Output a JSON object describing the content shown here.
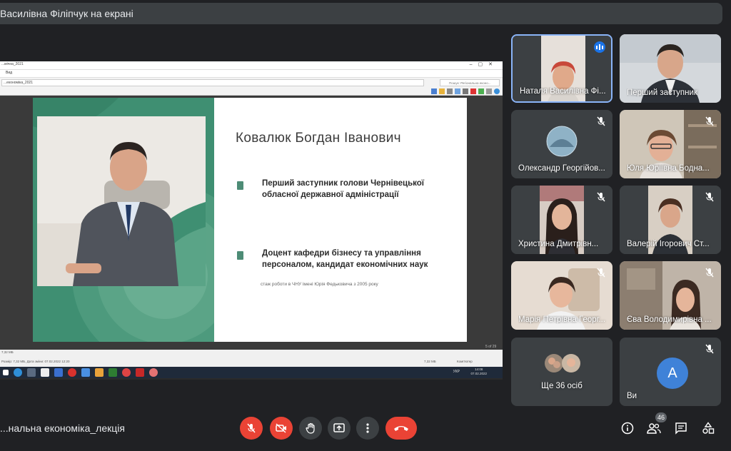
{
  "presenter_banner": "Василівна Філіпчук на екрані",
  "shared_window": {
    "title": "...мічна_2021",
    "menu": "Вид",
    "address": "...економіка_2021",
    "search_placeholder": "Пошук: Регіональна еконо...",
    "status_left": "Розмір: 7,32 МБ, Дата зміни: 07.02.2022 12:20",
    "status_size": "7,32 МБ",
    "status_computer": "Комп'ютер",
    "size_small": "7,32 МБ",
    "page_info": "5 of 29",
    "lang": "УКР",
    "time": "14:08",
    "date": "07.02.2022"
  },
  "slide": {
    "name": "Ковалюк Богдан Іванович",
    "bullet1": "Перший заступник голови Чернівецької обласної державної адміністрації",
    "bullet2": "Доцент кафедри бізнесу та управління персоналом, кандидат економічних наук",
    "note": "стаж роботи в ЧНУ імені Юрія Федьковича з 2005 року"
  },
  "participants": [
    {
      "name": "Наталя Василівна Фі...",
      "speaking": true
    },
    {
      "name": "Перший заступник",
      "muted": false
    },
    {
      "name": "Олександр Георгійов...",
      "muted": true
    },
    {
      "name": "Юля Юріївна Бодна...",
      "muted": true
    },
    {
      "name": "Христина Дмитрівн...",
      "muted": true
    },
    {
      "name": "Валерій Ігорович Ст...",
      "muted": true
    },
    {
      "name": "Марія Петрівна Георг...",
      "muted": true
    },
    {
      "name": "Єва Володимирівна ...",
      "muted": true
    },
    {
      "name": "Ще 36 осіб"
    },
    {
      "name": "Ви",
      "avatar_letter": "A",
      "muted": true
    }
  ],
  "meeting": {
    "title": "...нальна економіка_лекція",
    "participants_count": "46"
  },
  "colors": {
    "end_call": "#ea4335",
    "slide_green": "#3f8f72",
    "active_border": "#8ab4f8"
  }
}
